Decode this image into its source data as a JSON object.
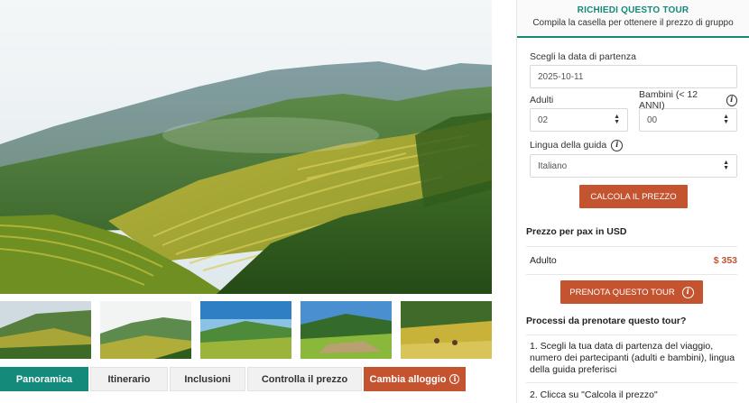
{
  "gallery": {
    "hero_alt": "Terraced rice fields in mountain valley",
    "thumbs": [
      "terraces-1",
      "terraces-2",
      "terraces-3",
      "terraces-4",
      "harvest-5"
    ]
  },
  "tabs": [
    {
      "label": "Panoramica"
    },
    {
      "label": "Itinerario"
    },
    {
      "label": "Inclusioni"
    },
    {
      "label": "Controlla il prezzo"
    },
    {
      "label": "Cambia alloggio"
    }
  ],
  "panel": {
    "title": "RICHIEDI QUESTO TOUR",
    "subtitle": "Compila la casella per ottenere il prezzo di gruppo",
    "date_label": "Scegli la data di partenza",
    "date_value": "2025-10-11",
    "adults_label": "Adulti",
    "adults_value": "02",
    "children_label": "Bambini (< 12 ANNI)",
    "children_value": "00",
    "language_label": "Lingua della guida",
    "language_value": "Italiano",
    "calc_button": "CALCOLA IL PREZZO",
    "price_heading": "Prezzo per pax in USD",
    "adult_label": "Adulto",
    "adult_price": "$ 353",
    "book_button": "PRENOTA QUESTO TOUR",
    "process_heading": "Processi da prenotare questo tour?",
    "step1": "1. Scegli la tua data di partenza del viaggio, numero dei partecipanti (adulti e bambini), lingua della guida preferisci",
    "step2": "2. Clicca su \"Calcola il prezzo\""
  },
  "colors": {
    "teal": "#138a7a",
    "orange": "#c4532f"
  },
  "icons": {
    "info": "info-icon"
  }
}
